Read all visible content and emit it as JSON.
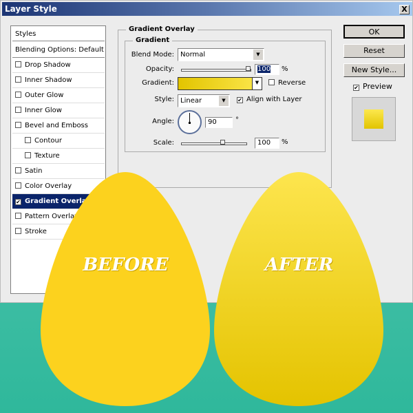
{
  "window": {
    "title": "Layer Style",
    "close": "X"
  },
  "styles_list": {
    "header": "Styles",
    "blending": "Blending Options: Default",
    "items": [
      {
        "label": "Drop Shadow",
        "checked": false
      },
      {
        "label": "Inner Shadow",
        "checked": false
      },
      {
        "label": "Outer Glow",
        "checked": false
      },
      {
        "label": "Inner Glow",
        "checked": false
      },
      {
        "label": "Bevel and Emboss",
        "checked": false
      },
      {
        "label": "Contour",
        "checked": false
      },
      {
        "label": "Texture",
        "checked": false
      },
      {
        "label": "Satin",
        "checked": false
      },
      {
        "label": "Color Overlay",
        "checked": false
      },
      {
        "label": "Gradient Overlay",
        "checked": true
      },
      {
        "label": "Pattern Overlay",
        "checked": false
      },
      {
        "label": "Stroke",
        "checked": false
      }
    ]
  },
  "panel": {
    "title": "Gradient Overlay",
    "group": "Gradient",
    "blend_mode_label": "Blend Mode:",
    "blend_mode": "Normal",
    "opacity_label": "Opacity:",
    "opacity": "100",
    "opacity_unit": "%",
    "gradient_label": "Gradient:",
    "gradient_colors": [
      "#e2c400",
      "#fce84e"
    ],
    "reverse_label": "Reverse",
    "reverse": false,
    "style_label": "Style:",
    "style": "Linear",
    "align_label": "Align with Layer",
    "align": true,
    "angle_label": "Angle:",
    "angle": "90",
    "angle_unit": "°",
    "scale_label": "Scale:",
    "scale": "100",
    "scale_unit": "%"
  },
  "buttons": {
    "ok": "OK",
    "reset": "Reset",
    "new_style": "New Style...",
    "preview": "Preview",
    "preview_checked": true
  },
  "eggs": {
    "before": "BEFORE",
    "after": "AFTER",
    "before_color": "#fcd21e",
    "after_colors": [
      "#fde54e",
      "#e4c300"
    ]
  }
}
